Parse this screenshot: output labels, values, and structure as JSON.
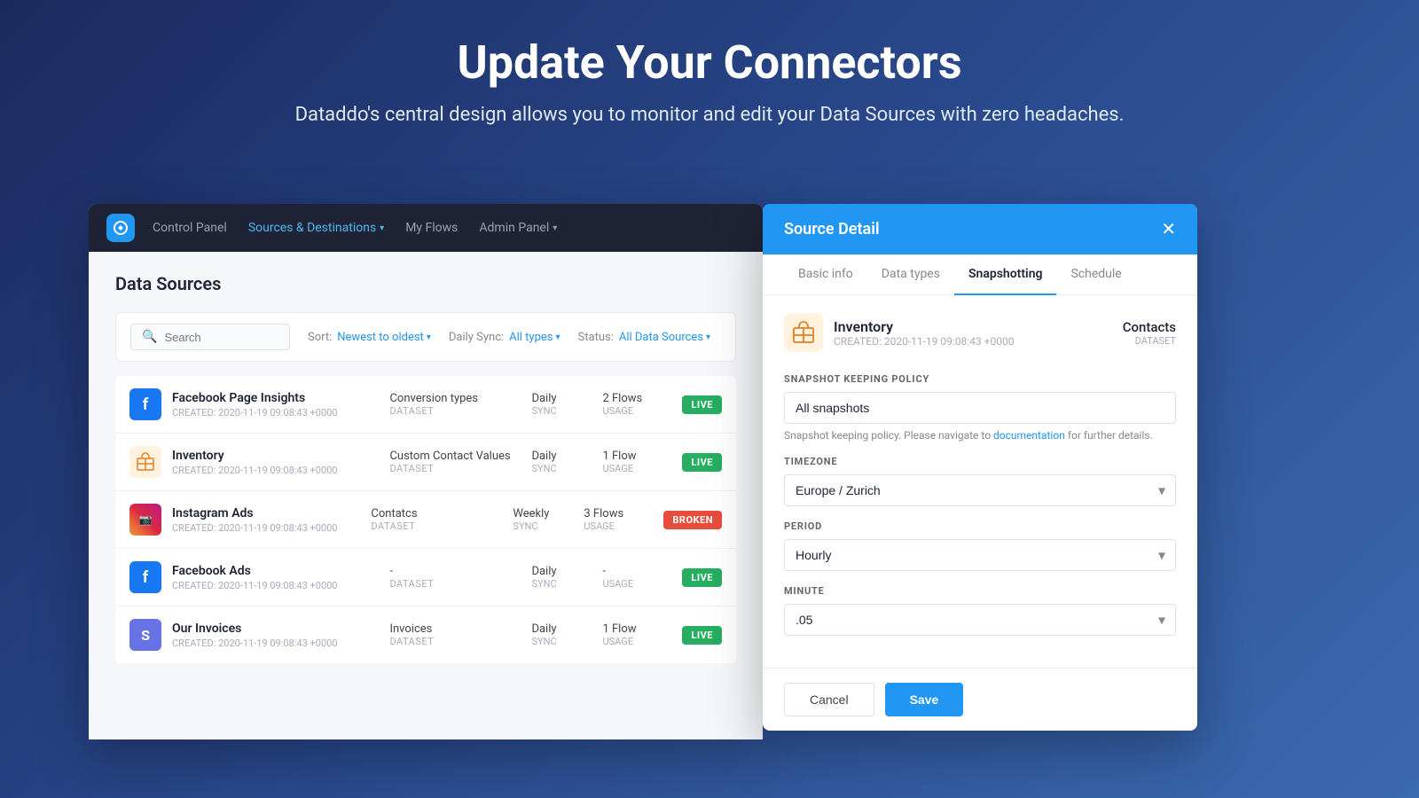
{
  "hero": {
    "title": "Update Your Connectors",
    "subtitle": "Dataddo's central design allows you to monitor and edit your Data Sources with zero headaches."
  },
  "nav": {
    "logo": "D",
    "items": [
      {
        "label": "Control Panel",
        "active": false
      },
      {
        "label": "Sources & Destinations",
        "active": true,
        "hasChevron": true
      },
      {
        "label": "My Flows",
        "active": false
      },
      {
        "label": "Admin Panel",
        "active": false,
        "hasChevron": true
      }
    ]
  },
  "content": {
    "title": "Data Sources",
    "search_placeholder": "Search",
    "sort_label": "Sort:",
    "sort_value": "Newest to oldest",
    "sync_label": "Daily Sync:",
    "sync_value": "All types",
    "status_label": "Status:",
    "status_value": "All Data Sources"
  },
  "rows": [
    {
      "name": "Facebook Page Insights",
      "date": "CREATED: 2020-11-19 09:08:43 +0000",
      "dataset": "Conversion types",
      "dataset_label": "DATASET",
      "sync": "Daily",
      "sync_label": "SYNC",
      "flows": "2 Flows",
      "flows_label": "USAGE",
      "status": "LIVE",
      "status_type": "live",
      "icon_type": "facebook"
    },
    {
      "name": "Inventory",
      "date": "CREATED: 2020-11-19 09:08:43 +0000",
      "dataset": "Custom Contact Values",
      "dataset_label": "DATASET",
      "sync": "Daily",
      "sync_label": "SYNC",
      "flows": "1 Flow",
      "flows_label": "USAGE",
      "status": "LIVE",
      "status_type": "live",
      "icon_type": "inventory"
    },
    {
      "name": "Instagram Ads",
      "date": "CREATED: 2020-11-19 09:08:43 +0000",
      "dataset": "Contatcs",
      "dataset_label": "DATASET",
      "sync": "Weekly",
      "sync_label": "SYNC",
      "flows": "3 Flows",
      "flows_label": "USAGE",
      "status": "BROKEN",
      "status_type": "broken",
      "icon_type": "instagram"
    },
    {
      "name": "Facebook Ads",
      "date": "CREATED: 2020-11-19 09:08:43 +0000",
      "dataset": "-",
      "dataset_label": "DATASET",
      "sync": "Daily",
      "sync_label": "SYNC",
      "flows": "-",
      "flows_label": "USAGE",
      "status": "LIVE",
      "status_type": "live",
      "icon_type": "facebook"
    },
    {
      "name": "Our Invoices",
      "date": "CREATED: 2020-11-19 09:08:43 +0000",
      "dataset": "Invoices",
      "dataset_label": "DATASET",
      "sync": "Daily",
      "sync_label": "SYNC",
      "flows": "1 Flow",
      "flows_label": "USAGE",
      "status": "LIVE",
      "status_type": "live",
      "icon_type": "stripe"
    }
  ],
  "detail": {
    "title": "Source Detail",
    "tabs": [
      "Basic info",
      "Data types",
      "Snapshotting",
      "Schedule"
    ],
    "active_tab": "Snapshotting",
    "source_name": "Inventory",
    "source_date": "CREATED: 2020-11-19 09:08:43 +0000",
    "dataset_name": "Contacts",
    "dataset_label": "DATASET",
    "snapshot_keeping_policy_label": "SNAPSHOT KEEPING POLICY",
    "snapshot_keeping_value": "All snapshots",
    "hint_text": "Snapshot keeping policy. Please navigate to",
    "hint_link": "documentation",
    "hint_suffix": "for further details.",
    "timezone_label": "TIMEZONE",
    "timezone_value": "Europe / Zurich",
    "period_label": "PERIOD",
    "period_value": "Hourly",
    "minute_label": "MINUTE",
    "minute_value": ".05",
    "cancel_label": "Cancel",
    "save_label": "Save"
  }
}
